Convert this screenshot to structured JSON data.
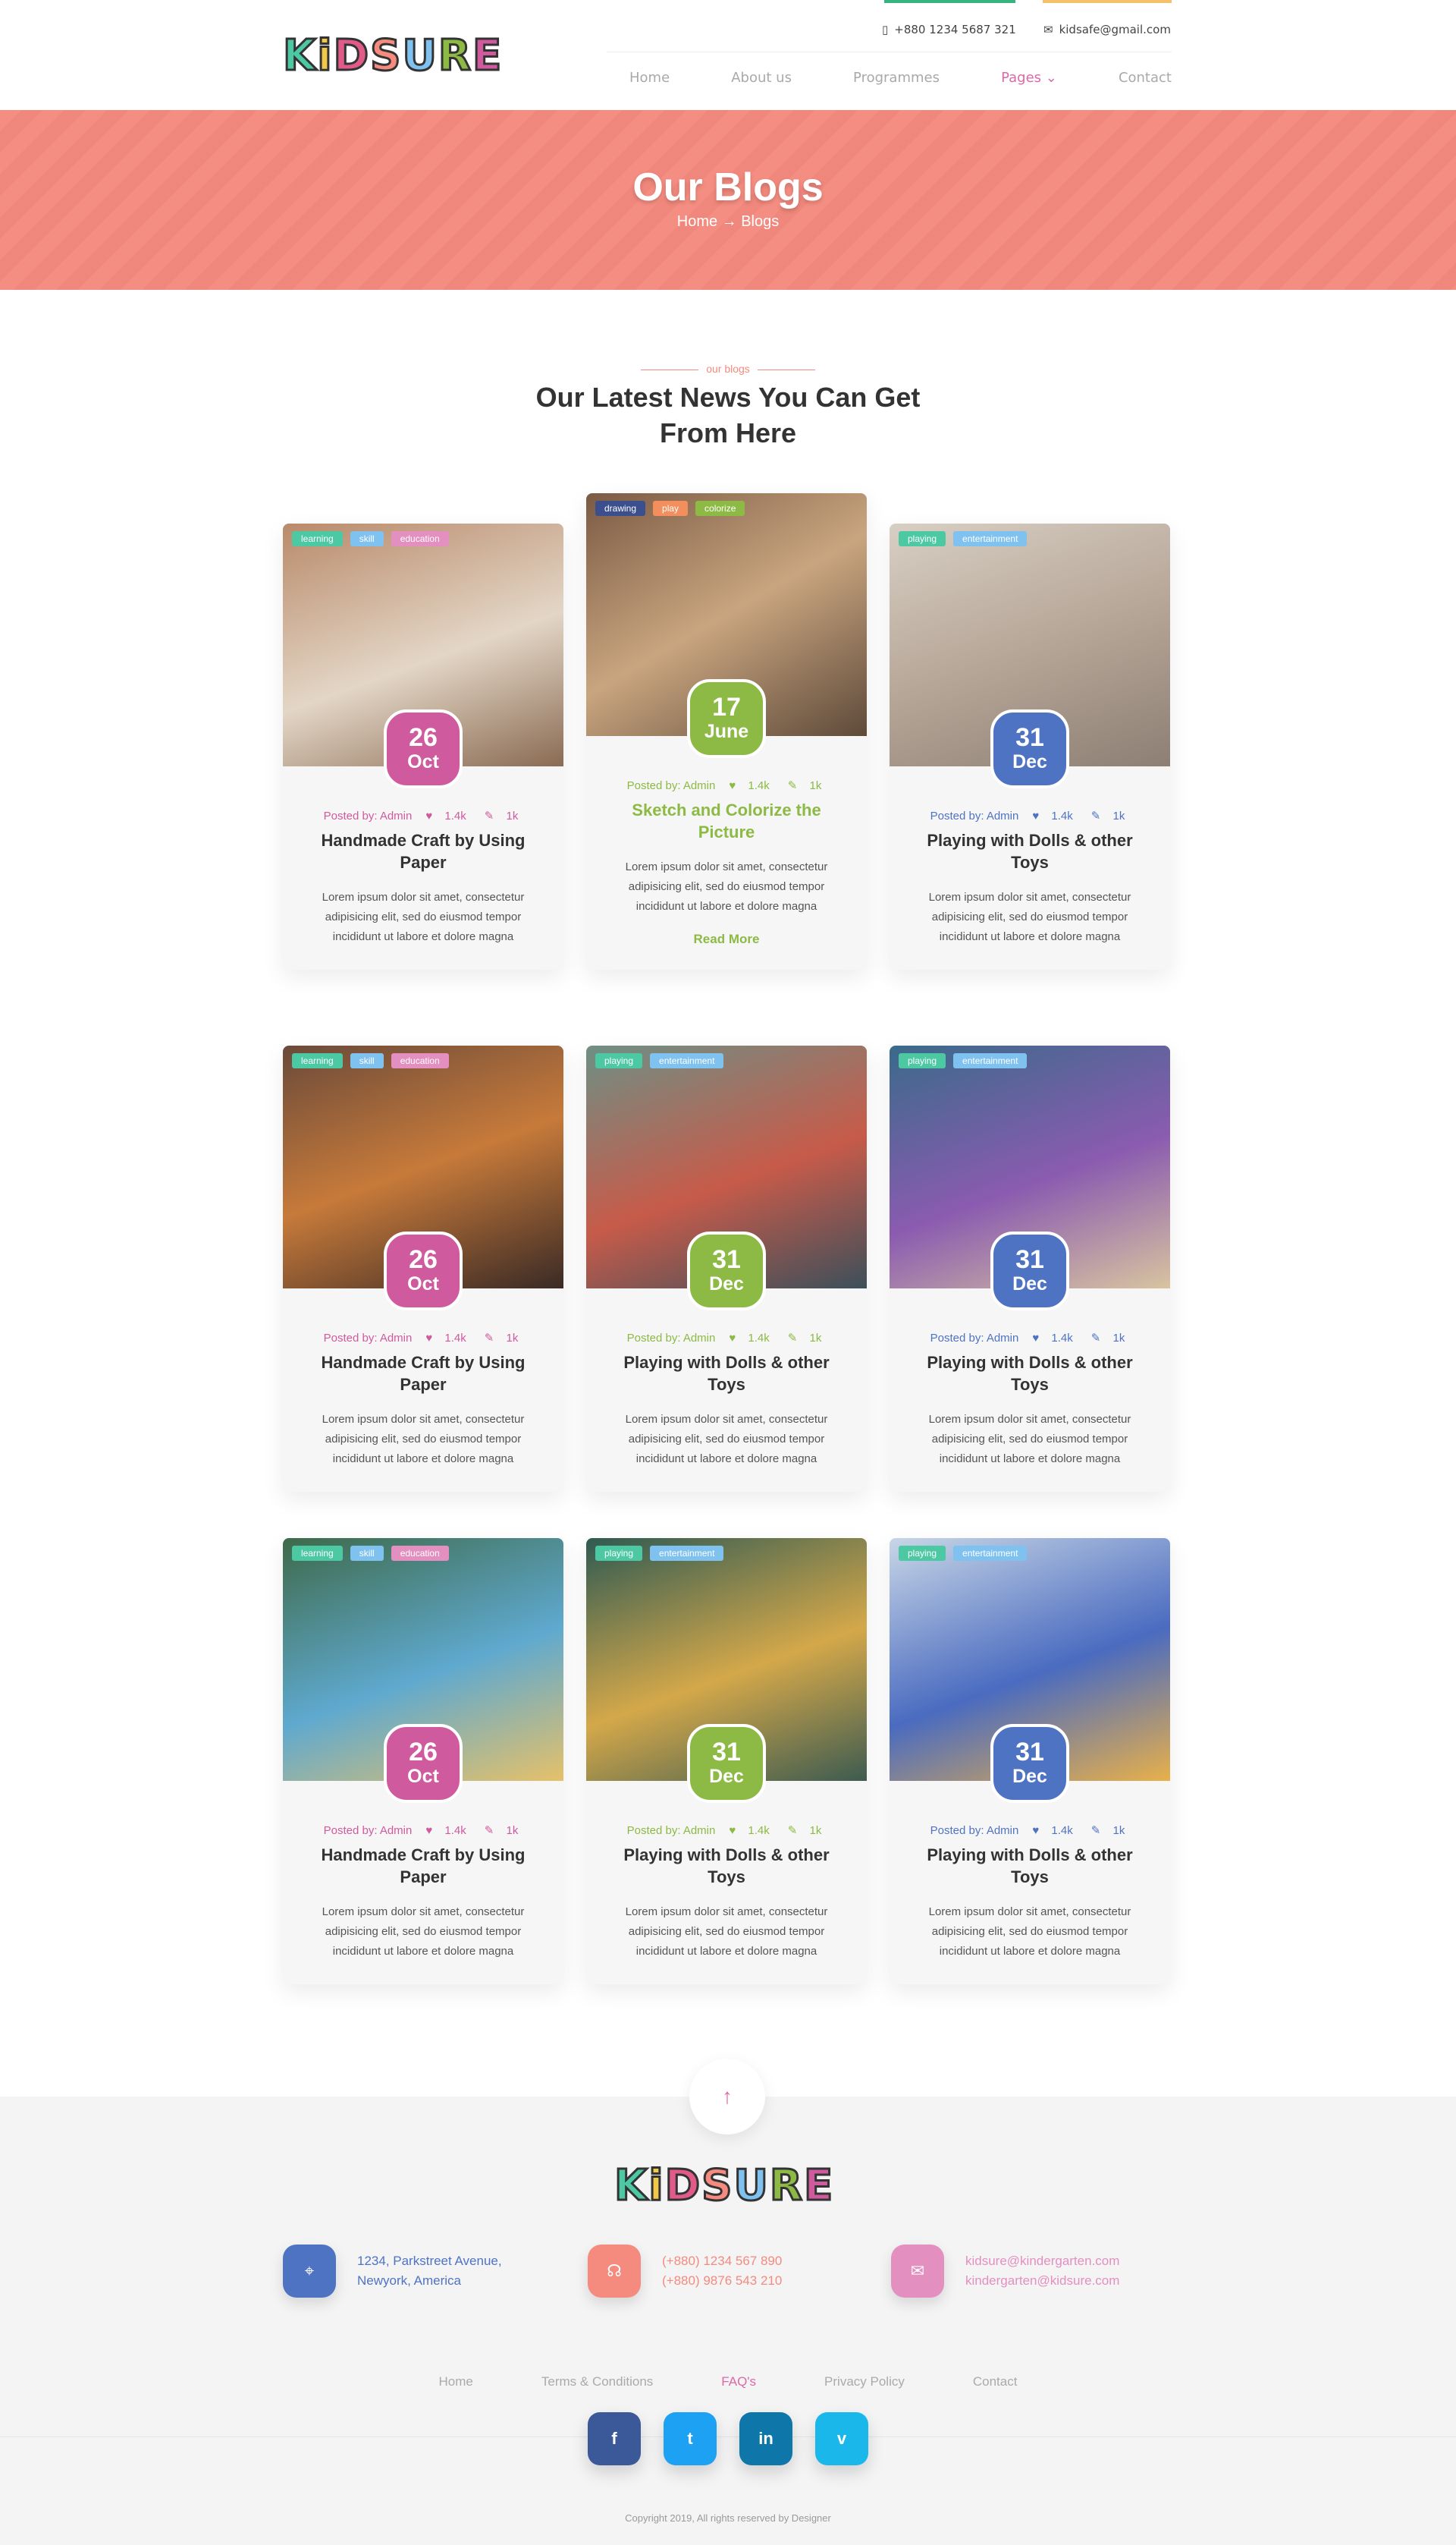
{
  "header": {
    "logo_text": "KiDSURE",
    "phone": "+880 1234 5687 321",
    "email": "kidsafe@gmail.com",
    "nav": [
      {
        "label": "Home"
      },
      {
        "label": "About us"
      },
      {
        "label": "Programmes"
      },
      {
        "label": "Pages"
      },
      {
        "label": "Contact"
      }
    ]
  },
  "hero": {
    "title": "Our Blogs",
    "breadcrumb": "Home → Blogs"
  },
  "section": {
    "label": "our blogs",
    "title": "Our Latest News You Can Get From Here"
  },
  "posts": [
    {
      "tags": [
        "learning",
        "skill",
        "education"
      ],
      "day": "26",
      "month": "Oct",
      "posted": "Posted by: Admin",
      "likes": "1.4k",
      "comments": "1k",
      "title": "Handmade Craft by Using Paper",
      "text": "Lorem ipsum dolor sit amet, consectetur adipisicing elit, sed do eiusmod tempor incididunt ut labore et dolore magna"
    },
    {
      "tags": [
        "drawing",
        "play",
        "colorize"
      ],
      "day": "17",
      "month": "June",
      "posted": "Posted by: Admin",
      "likes": "1.4k",
      "comments": "1k",
      "title": "Sketch and Colorize the Picture",
      "text": "Lorem ipsum dolor sit amet, consectetur adipisicing elit, sed do eiusmod tempor incididunt ut labore et dolore magna",
      "read_more": "Read More"
    },
    {
      "tags": [
        "playing",
        "entertainment"
      ],
      "day": "31",
      "month": "Dec",
      "posted": "Posted by: Admin",
      "likes": "1.4k",
      "comments": "1k",
      "title": "Playing with Dolls & other Toys",
      "text": "Lorem ipsum dolor sit amet, consectetur adipisicing elit, sed do eiusmod tempor incididunt ut labore et dolore magna"
    },
    {
      "tags": [
        "learning",
        "skill",
        "education"
      ],
      "day": "26",
      "month": "Oct",
      "posted": "Posted by: Admin",
      "likes": "1.4k",
      "comments": "1k",
      "title": "Handmade Craft by Using Paper",
      "text": "Lorem ipsum dolor sit amet, consectetur adipisicing elit, sed do eiusmod tempor incididunt ut labore et dolore magna"
    },
    {
      "tags": [
        "playing",
        "entertainment"
      ],
      "day": "31",
      "month": "Dec",
      "posted": "Posted by: Admin",
      "likes": "1.4k",
      "comments": "1k",
      "title": "Playing with Dolls & other Toys",
      "text": "Lorem ipsum dolor sit amet, consectetur adipisicing elit, sed do eiusmod tempor incididunt ut labore et dolore magna"
    },
    {
      "tags": [
        "playing",
        "entertainment"
      ],
      "day": "31",
      "month": "Dec",
      "posted": "Posted by: Admin",
      "likes": "1.4k",
      "comments": "1k",
      "title": "Playing with Dolls & other Toys",
      "text": "Lorem ipsum dolor sit amet, consectetur adipisicing elit, sed do eiusmod tempor incididunt ut labore et dolore magna"
    },
    {
      "tags": [
        "learning",
        "skill",
        "education"
      ],
      "day": "26",
      "month": "Oct",
      "posted": "Posted by: Admin",
      "likes": "1.4k",
      "comments": "1k",
      "title": "Handmade Craft by Using Paper",
      "text": "Lorem ipsum dolor sit amet, consectetur adipisicing elit, sed do eiusmod tempor incididunt ut labore et dolore magna"
    },
    {
      "tags": [
        "playing",
        "entertainment"
      ],
      "day": "31",
      "month": "Dec",
      "posted": "Posted by: Admin",
      "likes": "1.4k",
      "comments": "1k",
      "title": "Playing with Dolls & other Toys",
      "text": "Lorem ipsum dolor sit amet, consectetur adipisicing elit, sed do eiusmod tempor incididunt ut labore et dolore magna"
    },
    {
      "tags": [
        "playing",
        "entertainment"
      ],
      "day": "31",
      "month": "Dec",
      "posted": "Posted by: Admin",
      "likes": "1.4k",
      "comments": "1k",
      "title": "Playing with Dolls & other Toys",
      "text": "Lorem ipsum dolor sit amet, consectetur adipisicing elit, sed do eiusmod tempor incididunt ut labore et dolore magna"
    }
  ],
  "footer": {
    "logo_text": "KiDSURE",
    "address": [
      "1234, Parkstreet Avenue,",
      "Newyork, America"
    ],
    "phones": [
      "(+880) 1234 567 890",
      "(+880) 9876 543 210"
    ],
    "emails": [
      "kidsure@kindergarten.com",
      "kindergarten@kidsure.com"
    ],
    "links": [
      {
        "label": "Home"
      },
      {
        "label": "Terms & Conditions"
      },
      {
        "label": "FAQ's"
      },
      {
        "label": "Privacy Policy"
      },
      {
        "label": "Contact"
      }
    ],
    "socials": [
      {
        "glyph": "f"
      },
      {
        "glyph": "t"
      },
      {
        "glyph": "in"
      },
      {
        "glyph": "v"
      }
    ],
    "copyright": "Copyright 2019, All rights reserved by Designer"
  },
  "colors": {
    "pink": "#d05a9e",
    "green": "#8cba44",
    "blue": "#4f73c3",
    "coral": "#f58a7e",
    "tag_teal": "#4cc8a3",
    "tag_lightblue": "#7fc1ef",
    "tag_pink": "#e38fc0",
    "tag_navy": "#3b4f8f",
    "tag_orange": "#f28f5d",
    "tag_olive": "#8cba44"
  }
}
